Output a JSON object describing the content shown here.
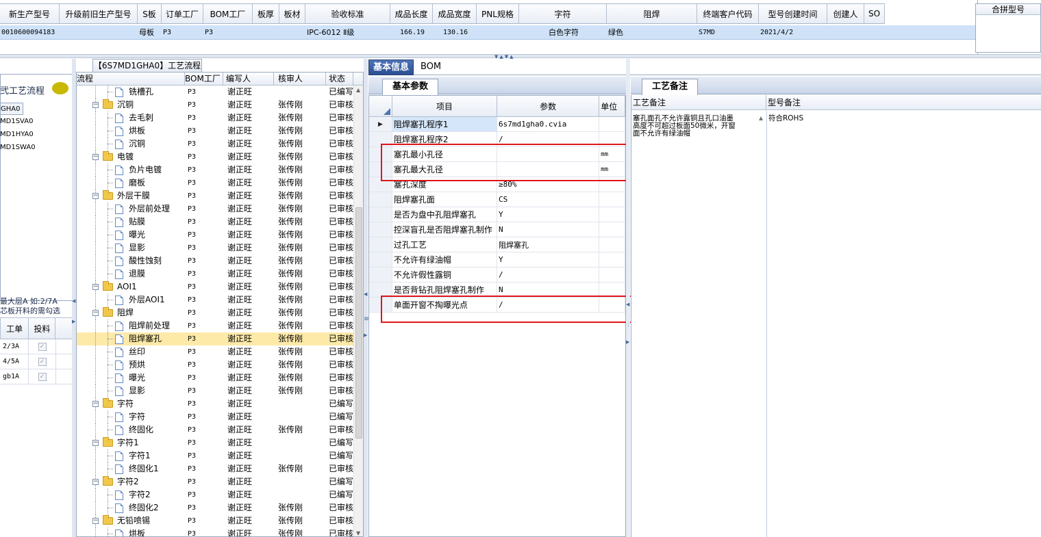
{
  "top_grid": {
    "headers": [
      "新生产型号",
      "升级前旧生产型号",
      "S板",
      "订单工厂",
      "BOM工厂",
      "板厚",
      "板材",
      "验收标准",
      "成品长度",
      "成品宽度",
      "PNL规格",
      "字符",
      "阻焊",
      "终端客户代码",
      "型号创建时间",
      "创建人",
      "SO"
    ],
    "row": {
      "new_model": "0010600094183",
      "old_model": "",
      "s_board": "母板",
      "order_factory": "P3",
      "bom_factory": "P3",
      "thickness": "",
      "material": "",
      "standard": "IPC-6012 Ⅱ级",
      "length": "166.19",
      "width": "130.16",
      "pnl": "",
      "char": "白色字符",
      "solder": "绿色",
      "customer": "S7MD",
      "created": "2021/4/2",
      "creator": "",
      "so": ""
    },
    "merge_title": "合拼型号"
  },
  "left_panel": {
    "title": "弐工艺流程",
    "items": [
      "GHA0",
      "MD1SVA0",
      "MD1HYA0",
      "MD1SWA0"
    ],
    "note_line1": "最大层A 如:2/7A",
    "note_line2": "芯板开料的需勾选",
    "table_headers": [
      "工单",
      "投料"
    ],
    "table_rows": [
      "2/3A",
      "4/5A",
      "gb1A"
    ]
  },
  "tree": {
    "title": "【6S7MD1GHA0】工艺流程",
    "headers": [
      "流程",
      "BOM工厂",
      "编写人",
      "核审人",
      "状态"
    ],
    "rows": [
      {
        "name": "铣槽孔",
        "level": 2,
        "type": "file",
        "bom": "P3",
        "writer": "谢正旺",
        "reviewer": "",
        "status": "已编写"
      },
      {
        "name": "沉铜",
        "level": 1,
        "type": "folder",
        "bom": "P3",
        "writer": "谢正旺",
        "reviewer": "张传刚",
        "status": "已审核"
      },
      {
        "name": "去毛刺",
        "level": 2,
        "type": "file",
        "bom": "P3",
        "writer": "谢正旺",
        "reviewer": "张传刚",
        "status": "已审核"
      },
      {
        "name": "烘板",
        "level": 2,
        "type": "file",
        "bom": "P3",
        "writer": "谢正旺",
        "reviewer": "张传刚",
        "status": "已审核"
      },
      {
        "name": "沉铜",
        "level": 2,
        "type": "file",
        "bom": "P3",
        "writer": "谢正旺",
        "reviewer": "张传刚",
        "status": "已审核"
      },
      {
        "name": "电镀",
        "level": 1,
        "type": "folder",
        "bom": "P3",
        "writer": "谢正旺",
        "reviewer": "张传刚",
        "status": "已审核"
      },
      {
        "name": "负片电镀",
        "level": 2,
        "type": "file",
        "bom": "P3",
        "writer": "谢正旺",
        "reviewer": "张传刚",
        "status": "已审核"
      },
      {
        "name": "磨板",
        "level": 2,
        "type": "file",
        "bom": "P3",
        "writer": "谢正旺",
        "reviewer": "张传刚",
        "status": "已审核"
      },
      {
        "name": "外层干膜",
        "level": 1,
        "type": "folder",
        "bom": "P3",
        "writer": "谢正旺",
        "reviewer": "张传刚",
        "status": "已审核"
      },
      {
        "name": "外层前处理",
        "level": 2,
        "type": "file",
        "bom": "P3",
        "writer": "谢正旺",
        "reviewer": "张传刚",
        "status": "已审核"
      },
      {
        "name": "贴膜",
        "level": 2,
        "type": "file",
        "bom": "P3",
        "writer": "谢正旺",
        "reviewer": "张传刚",
        "status": "已审核"
      },
      {
        "name": "曝光",
        "level": 2,
        "type": "file",
        "bom": "P3",
        "writer": "谢正旺",
        "reviewer": "张传刚",
        "status": "已审核"
      },
      {
        "name": "显影",
        "level": 2,
        "type": "file",
        "bom": "P3",
        "writer": "谢正旺",
        "reviewer": "张传刚",
        "status": "已审核"
      },
      {
        "name": "酸性蚀刻",
        "level": 2,
        "type": "file",
        "bom": "P3",
        "writer": "谢正旺",
        "reviewer": "张传刚",
        "status": "已审核"
      },
      {
        "name": "退膜",
        "level": 2,
        "type": "file",
        "bom": "P3",
        "writer": "谢正旺",
        "reviewer": "张传刚",
        "status": "已审核"
      },
      {
        "name": "AOI1",
        "level": 1,
        "type": "folder",
        "bom": "P3",
        "writer": "谢正旺",
        "reviewer": "张传刚",
        "status": "已审核"
      },
      {
        "name": "外层AOI1",
        "level": 2,
        "type": "file",
        "bom": "P3",
        "writer": "谢正旺",
        "reviewer": "张传刚",
        "status": "已审核"
      },
      {
        "name": "阻焊",
        "level": 1,
        "type": "folder",
        "bom": "P3",
        "writer": "谢正旺",
        "reviewer": "张传刚",
        "status": "已审核"
      },
      {
        "name": "阻焊前处理",
        "level": 2,
        "type": "file",
        "bom": "P3",
        "writer": "谢正旺",
        "reviewer": "张传刚",
        "status": "已审核"
      },
      {
        "name": "阻焊塞孔",
        "level": 2,
        "type": "file",
        "bom": "P3",
        "writer": "谢正旺",
        "reviewer": "张传刚",
        "status": "已审核",
        "selected": true
      },
      {
        "name": "丝印",
        "level": 2,
        "type": "file",
        "bom": "P3",
        "writer": "谢正旺",
        "reviewer": "张传刚",
        "status": "已审核"
      },
      {
        "name": "预烘",
        "level": 2,
        "type": "file",
        "bom": "P3",
        "writer": "谢正旺",
        "reviewer": "张传刚",
        "status": "已审核"
      },
      {
        "name": "曝光",
        "level": 2,
        "type": "file",
        "bom": "P3",
        "writer": "谢正旺",
        "reviewer": "张传刚",
        "status": "已审核"
      },
      {
        "name": "显影",
        "level": 2,
        "type": "file",
        "bom": "P3",
        "writer": "谢正旺",
        "reviewer": "张传刚",
        "status": "已审核"
      },
      {
        "name": "字符",
        "level": 1,
        "type": "folder",
        "bom": "P3",
        "writer": "谢正旺",
        "reviewer": "",
        "status": "已编写"
      },
      {
        "name": "字符",
        "level": 2,
        "type": "file",
        "bom": "P3",
        "writer": "谢正旺",
        "reviewer": "",
        "status": "已编写"
      },
      {
        "name": "终固化",
        "level": 2,
        "type": "file",
        "bom": "P3",
        "writer": "谢正旺",
        "reviewer": "张传刚",
        "status": "已审核"
      },
      {
        "name": "字符1",
        "level": 1,
        "type": "folder",
        "bom": "P3",
        "writer": "谢正旺",
        "reviewer": "",
        "status": "已编写"
      },
      {
        "name": "字符1",
        "level": 2,
        "type": "file",
        "bom": "P3",
        "writer": "谢正旺",
        "reviewer": "",
        "status": "已编写"
      },
      {
        "name": "终固化1",
        "level": 2,
        "type": "file",
        "bom": "P3",
        "writer": "谢正旺",
        "reviewer": "张传刚",
        "status": "已审核"
      },
      {
        "name": "字符2",
        "level": 1,
        "type": "folder",
        "bom": "P3",
        "writer": "谢正旺",
        "reviewer": "",
        "status": "已编写"
      },
      {
        "name": "字符2",
        "level": 2,
        "type": "file",
        "bom": "P3",
        "writer": "谢正旺",
        "reviewer": "",
        "status": "已编写"
      },
      {
        "name": "终固化2",
        "level": 2,
        "type": "file",
        "bom": "P3",
        "writer": "谢正旺",
        "reviewer": "张传刚",
        "status": "已审核"
      },
      {
        "name": "无铅喷锡",
        "level": 1,
        "type": "folder",
        "bom": "P3",
        "writer": "谢正旺",
        "reviewer": "张传刚",
        "status": "已审核"
      },
      {
        "name": "烘板",
        "level": 2,
        "type": "file",
        "bom": "P3",
        "writer": "谢正旺",
        "reviewer": "张传刚",
        "status": "已审核"
      }
    ]
  },
  "info": {
    "tabs": [
      "基本信息",
      "BOM"
    ],
    "subtab": "基本参数",
    "headers": [
      "项目",
      "参数",
      "单位"
    ],
    "rows": [
      {
        "item": "阻焊塞孔程序1",
        "param": "6s7md1gha0.cvia",
        "unit": "",
        "current": true
      },
      {
        "item": "阻焊塞孔程序2",
        "param": "/",
        "unit": ""
      },
      {
        "item": "塞孔最小孔径",
        "param": "",
        "unit": "mm"
      },
      {
        "item": "塞孔最大孔径",
        "param": "",
        "unit": "mm"
      },
      {
        "item": "塞孔深度",
        "param": "≥80%",
        "unit": ""
      },
      {
        "item": "阻焊塞孔面",
        "param": "CS",
        "unit": ""
      },
      {
        "item": "是否为盘中孔阻焊塞孔",
        "param": "Y",
        "unit": ""
      },
      {
        "item": "控深盲孔是否阻焊塞孔制作",
        "param": "N",
        "unit": ""
      },
      {
        "item": "过孔工艺",
        "param": "阻焊塞孔",
        "unit": ""
      },
      {
        "item": "不允许有绿油帽",
        "param": "Y",
        "unit": ""
      },
      {
        "item": "不允许假性露铜",
        "param": "/",
        "unit": ""
      },
      {
        "item": "是否背钻孔阻焊塞孔制作",
        "param": "N",
        "unit": ""
      },
      {
        "item": "单面开窗不掏曝光点",
        "param": "/",
        "unit": ""
      }
    ]
  },
  "remarks": {
    "subtab": "工艺备注",
    "headers": [
      "工艺备注",
      "型号备注"
    ],
    "process_note_lines": [
      "塞孔面孔不允许露铜且孔口油墨",
      "高度不可超过板面50微米，开窗",
      "面不允许有绿油帽"
    ],
    "model_note": "符合ROHS"
  }
}
